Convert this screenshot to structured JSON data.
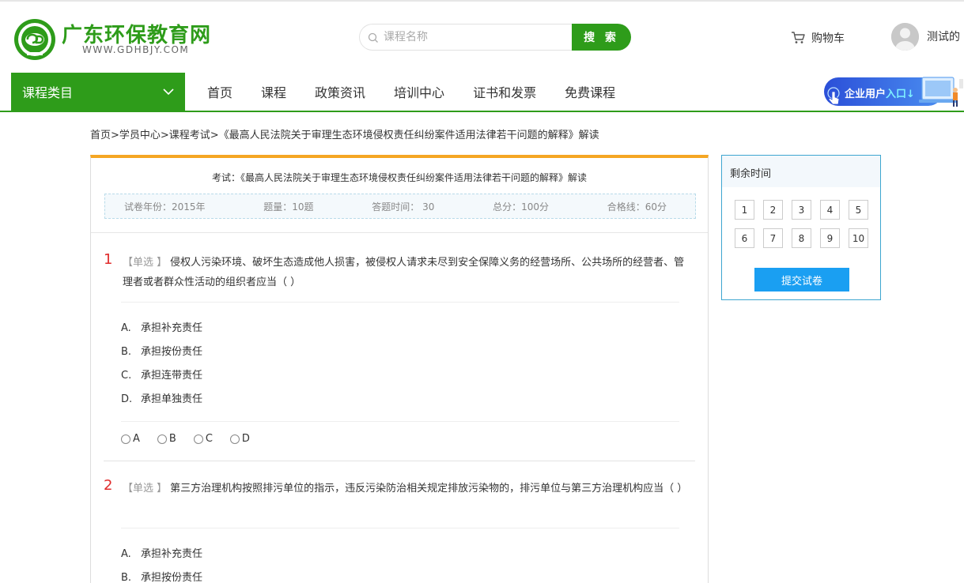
{
  "header": {
    "site_title": "广东环保教育网",
    "site_url": "WWW.GDHBJY.COM",
    "search_placeholder": "课程名称",
    "search_button": "搜 索",
    "cart_label": "购物车",
    "user_name": "测试的"
  },
  "nav": {
    "category_label": "课程类目",
    "links": [
      "首页",
      "课程",
      "政策资讯",
      "培训中心",
      "证书和发票",
      "免费课程"
    ],
    "enterprise_prefix": "企业用户",
    "enterprise_suffix": "入口"
  },
  "breadcrumb": "首页>学员中心>课程考试>《最高人民法院关于审理生态环境侵权责任纠纷案件适用法律若干问题的解释》解读",
  "exam": {
    "title": "考试：《最高人民法院关于审理生态环境侵权责任纠纷案件适用法律若干问题的解释》解读",
    "meta": {
      "year": "试卷年份：2015年",
      "count": "题量：10题",
      "time": "答题时间： 30",
      "total": "总分：100分",
      "pass": "合格线：60分"
    },
    "questions": [
      {
        "num": "1",
        "type": "【单选 】",
        "text": "侵权人污染环境、破坏生态造成他人损害，被侵权人请求未尽到安全保障义务的经营场所、公共场所的经营者、管理者或者群众性活动的组织者应当（ ）",
        "options": [
          {
            "letter": "A.",
            "text": "承担补充责任"
          },
          {
            "letter": "B.",
            "text": "承担按份责任"
          },
          {
            "letter": "C.",
            "text": "承担连带责任"
          },
          {
            "letter": "D.",
            "text": "承担单独责任"
          }
        ],
        "choices": [
          "A",
          "B",
          "C",
          "D"
        ]
      },
      {
        "num": "2",
        "type": "【单选 】",
        "text": "第三方治理机构按照排污单位的指示，违反污染防治相关规定排放污染物的，排污单位与第三方治理机构应当（ ）",
        "options": [
          {
            "letter": "A.",
            "text": "承担补充责任"
          },
          {
            "letter": "B.",
            "text": "承担按份责任"
          }
        ]
      }
    ]
  },
  "sidebar": {
    "title": "剩余时间",
    "numbers": [
      "1",
      "2",
      "3",
      "4",
      "5",
      "6",
      "7",
      "8",
      "9",
      "10"
    ],
    "submit_label": "提交试卷"
  },
  "colors": {
    "brand_green": "#2e9c1a",
    "accent_orange": "#f5a623",
    "accent_blue": "#1a9ff2",
    "question_number_red": "#e02b2b"
  }
}
